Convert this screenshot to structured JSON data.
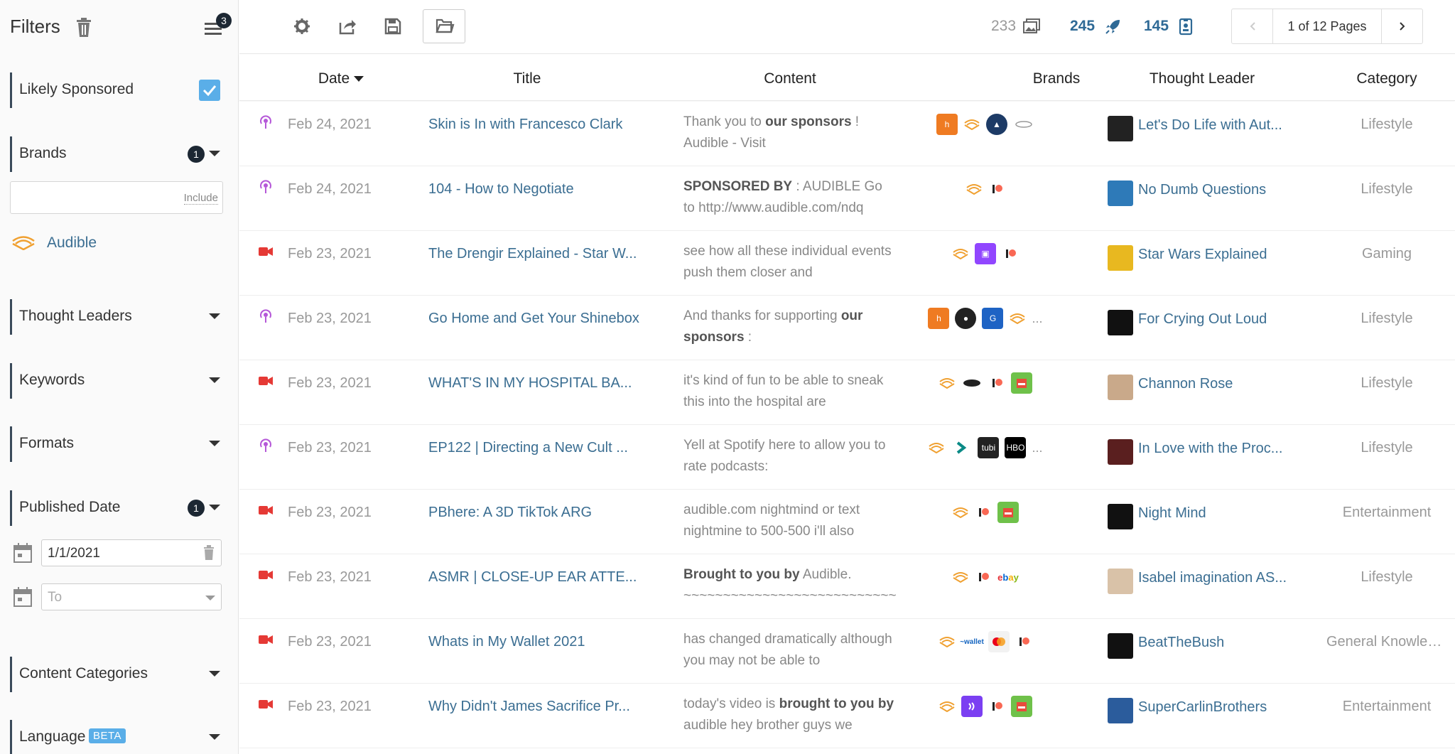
{
  "sidebar": {
    "title": "Filters",
    "menu_badge": "3",
    "likely_sponsored": {
      "label": "Likely Sponsored",
      "checked": true
    },
    "brands": {
      "label": "Brands",
      "count": "1",
      "input_value": "",
      "include_label": "Include",
      "selected": [
        "Audible"
      ]
    },
    "thought_leaders": {
      "label": "Thought Leaders"
    },
    "keywords": {
      "label": "Keywords"
    },
    "formats": {
      "label": "Formats"
    },
    "published_date": {
      "label": "Published Date",
      "count": "1",
      "from": "1/1/2021",
      "to_placeholder": "To"
    },
    "content_categories": {
      "label": "Content Categories"
    },
    "language": {
      "label": "Language",
      "badge": "BETA"
    }
  },
  "toolbar": {
    "stats": {
      "images": "233",
      "sponsored": "245",
      "brands": "145"
    },
    "pager": {
      "info": "1 of 12 Pages"
    }
  },
  "table": {
    "columns": {
      "date": "Date",
      "title": "Title",
      "content": "Content",
      "brands": "Brands",
      "thought_leader": "Thought Leader",
      "category": "Category"
    },
    "rows": [
      {
        "format": "podcast",
        "date": "Feb 24, 2021",
        "title": "Skin is In with Francesco Clark",
        "content_html": "Thank you to <b>our sponsors</b> ! Audible - Visit",
        "brands": [
          "honey",
          "audible",
          "upward",
          "oval"
        ],
        "more": "",
        "thought_leader": "Let's Do Life with Aut...",
        "tl_color": "#222",
        "category": "Lifestyle"
      },
      {
        "format": "podcast",
        "date": "Feb 24, 2021",
        "title": "104 - How to Negotiate",
        "content_html": "<b>SPONSORED BY</b> : AUDIBLE Go to  http://www.audible.com/ndq",
        "brands": [
          "audible",
          "patreon"
        ],
        "more": "",
        "thought_leader": "No Dumb Questions",
        "tl_color": "#2e7ab8",
        "category": "Lifestyle"
      },
      {
        "format": "video",
        "date": "Feb 23, 2021",
        "title": "The Drengir Explained - Star W...",
        "content_html": "see how all these individual events push them closer and",
        "brands": [
          "audible",
          "twitch",
          "patreon"
        ],
        "more": "",
        "thought_leader": "Star Wars Explained",
        "tl_color": "#e8b820",
        "category": "Gaming"
      },
      {
        "format": "podcast",
        "date": "Feb 23, 2021",
        "title": "Go Home and Get Your Shinebox",
        "content_html": "And thanks for supporting <b>our sponsors</b> :",
        "brands": [
          "honey",
          "dark-round",
          "g-box",
          "audible"
        ],
        "more": "...",
        "thought_leader": "For Crying Out Loud",
        "tl_color": "#111",
        "category": "Lifestyle"
      },
      {
        "format": "video",
        "date": "Feb 23, 2021",
        "title": "WHAT'S IN MY HOSPITAL BA...",
        "content_html": "it's kind of fun to be able to sneak this into the hospital are",
        "brands": [
          "audible",
          "oval-dark",
          "patreon",
          "green-badge"
        ],
        "more": "",
        "thought_leader": "Channon Rose",
        "tl_color": "#c9a98a",
        "category": "Lifestyle"
      },
      {
        "format": "podcast",
        "date": "Feb 23, 2021",
        "title": "EP122 | Directing a New Cult ...",
        "content_html": "Yell at Spotify here to allow you to rate podcasts:",
        "brands": [
          "audible",
          "arrow",
          "tubi",
          "hbo"
        ],
        "more": "...",
        "thought_leader": "In Love with the Proc...",
        "tl_color": "#5a1f1f",
        "category": "Lifestyle"
      },
      {
        "format": "video",
        "date": "Feb 23, 2021",
        "title": "PBhere: A 3D TikTok ARG",
        "content_html": "audible.com nightmind or text nightmine to 500-500 i'll also",
        "brands": [
          "audible",
          "patreon",
          "green-badge"
        ],
        "more": "",
        "thought_leader": "Night Mind",
        "tl_color": "#111",
        "category": "Entertainment"
      },
      {
        "format": "video",
        "date": "Feb 23, 2021",
        "title": "ASMR | CLOSE-UP EAR ATTE...",
        "content_html": "<b>Brought to you by</b> Audible. ~~~~~~~~~~~~~~~~~~~~~~~~~~~~~~",
        "brands": [
          "audible",
          "patreon",
          "ebay"
        ],
        "more": "",
        "thought_leader": "Isabel imagination AS...",
        "tl_color": "#d9c2a8",
        "category": "Lifestyle"
      },
      {
        "format": "video",
        "date": "Feb 23, 2021",
        "title": "Whats in My Wallet 2021",
        "content_html": "has changed dramatically although you may not be able to",
        "brands": [
          "audible",
          "wallet-blue",
          "mastercard",
          "patreon"
        ],
        "more": "",
        "thought_leader": "BeatTheBush",
        "tl_color": "#111",
        "category": "General Knowled..."
      },
      {
        "format": "video",
        "date": "Feb 23, 2021",
        "title": "Why Didn't James Sacrifice Pr...",
        "content_html": "today's video is <b>brought to you by</b> audible hey brother guys we",
        "brands": [
          "audible",
          "purple-wave",
          "patreon",
          "green-badge"
        ],
        "more": "",
        "thought_leader": "SuperCarlinBrothers",
        "tl_color": "#2b5c9c",
        "category": "Entertainment"
      }
    ]
  },
  "colors": {
    "link": "#3b6e92",
    "accent": "#5aaee8",
    "badge": "#1c2733",
    "video": "#e53935",
    "podcast": "#b558d8"
  }
}
